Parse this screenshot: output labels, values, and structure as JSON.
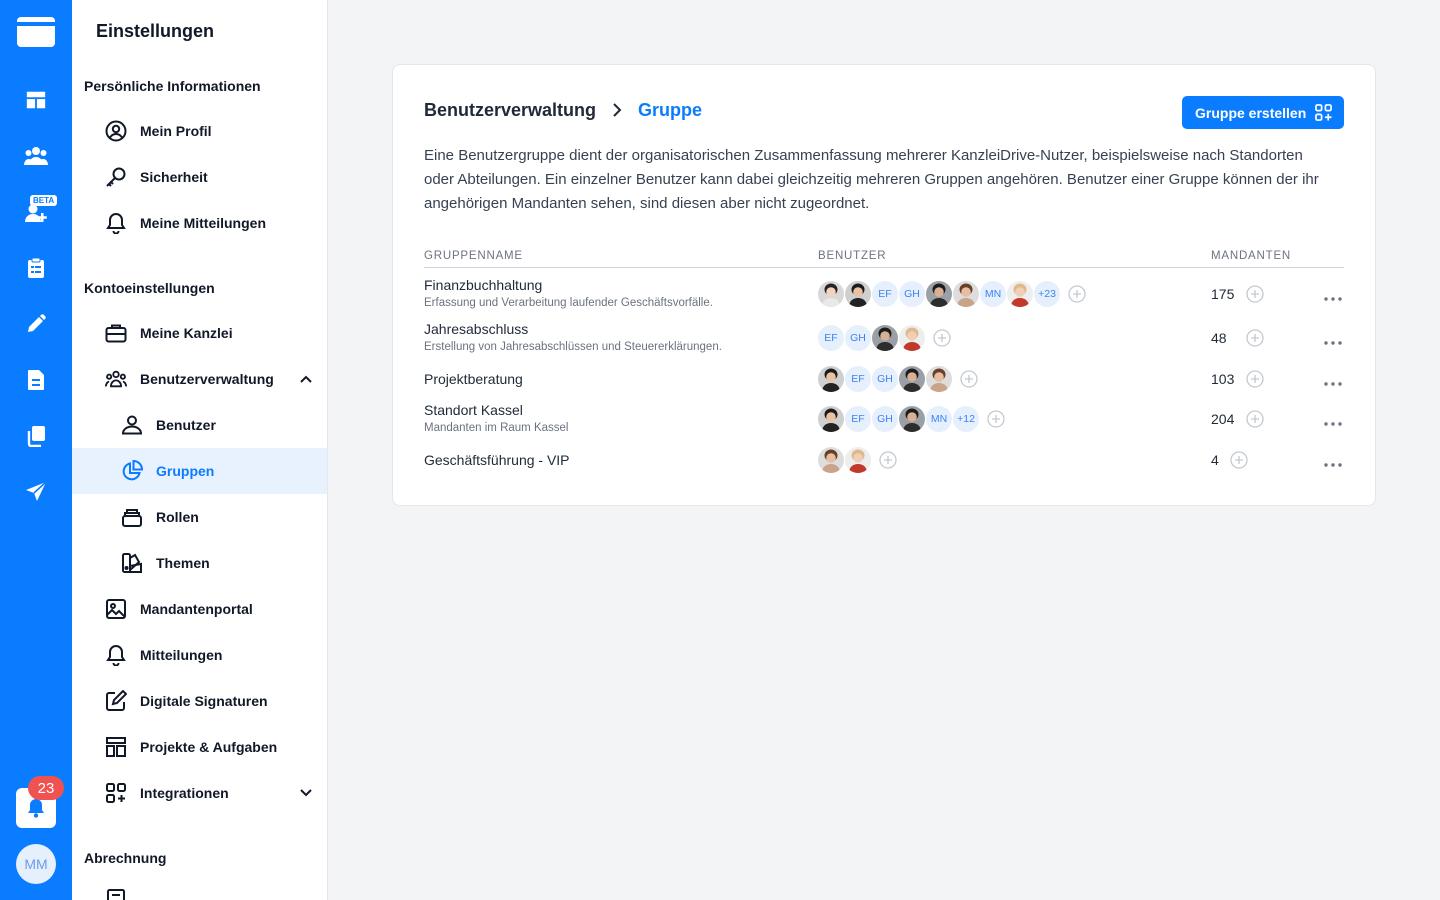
{
  "rail": {
    "beta_label": "BETA",
    "notification_count": "23",
    "avatar_initials": "MM",
    "icons": [
      "folder-logo-icon",
      "dashboard-icon",
      "users-icon",
      "add-user-icon",
      "clipboard-icon",
      "pencil-icon",
      "document-icon",
      "copy-icon",
      "send-icon",
      "bell-icon"
    ]
  },
  "settings": {
    "title": "Einstellungen",
    "sections": {
      "personal": "Persönliche Informationen",
      "account": "Kontoeinstellungen",
      "billing": "Abrechnung"
    },
    "items": {
      "profile": "Mein Profil",
      "security": "Sicherheit",
      "my_notifications": "Meine Mitteilungen",
      "firm": "Meine Kanzlei",
      "user_management": "Benutzerverwaltung",
      "users": "Benutzer",
      "groups": "Gruppen",
      "roles": "Rollen",
      "themes": "Themen",
      "client_portal": "Mandantenportal",
      "notifications": "Mitteilungen",
      "signatures": "Digitale Signaturen",
      "projects": "Projekte & Aufgaben",
      "integrations": "Integrationen"
    }
  },
  "main": {
    "breadcrumb_root": "Benutzerverwaltung",
    "breadcrumb_current": "Gruppe",
    "create_button": "Gruppe erstellen",
    "description": "Eine Benutzergruppe dient der organisatorischen Zusammenfassung mehrerer KanzleiDrive-Nutzer, beispielsweise nach Standorten oder Abteilungen. Ein einzelner Benutzer kann dabei gleichzeitig mehreren Gruppen angehören. Benutzer einer Gruppe können der ihr angehörigen Mandanten sehen, sind diesen aber nicht zugeordnet.",
    "columns": {
      "name": "Gruppenname",
      "users": "Benutzer",
      "clients": "Mandanten"
    },
    "groups": [
      {
        "name": "Finanzbuchhaltung",
        "desc": "Erfassung und Verarbeitung laufender Geschäftsvorfälle.",
        "clients": "175",
        "members": [
          "photo:f1",
          "photo:m1",
          "EF",
          "GH",
          "photo:m2",
          "photo:f2",
          "MN",
          "photo:f3",
          "+23"
        ]
      },
      {
        "name": "Jahresabschluss",
        "desc": "Erstellung von Jahresabschlüssen und Steuererklärungen.",
        "clients": "48",
        "members": [
          "EF",
          "GH",
          "photo:m2",
          "photo:f3"
        ]
      },
      {
        "name": "Projektberatung",
        "desc": "",
        "clients": "103",
        "members": [
          "photo:m1",
          "EF",
          "GH",
          "photo:m2",
          "photo:f2"
        ]
      },
      {
        "name": "Standort Kassel",
        "desc": "Mandanten im Raum Kassel",
        "clients": "204",
        "members": [
          "photo:m1",
          "EF",
          "GH",
          "photo:m2",
          "MN",
          "+12"
        ]
      },
      {
        "name": "Geschäftsführung - VIP",
        "desc": "",
        "clients": "4",
        "members": [
          "photo:f2",
          "photo:f3"
        ]
      }
    ]
  }
}
